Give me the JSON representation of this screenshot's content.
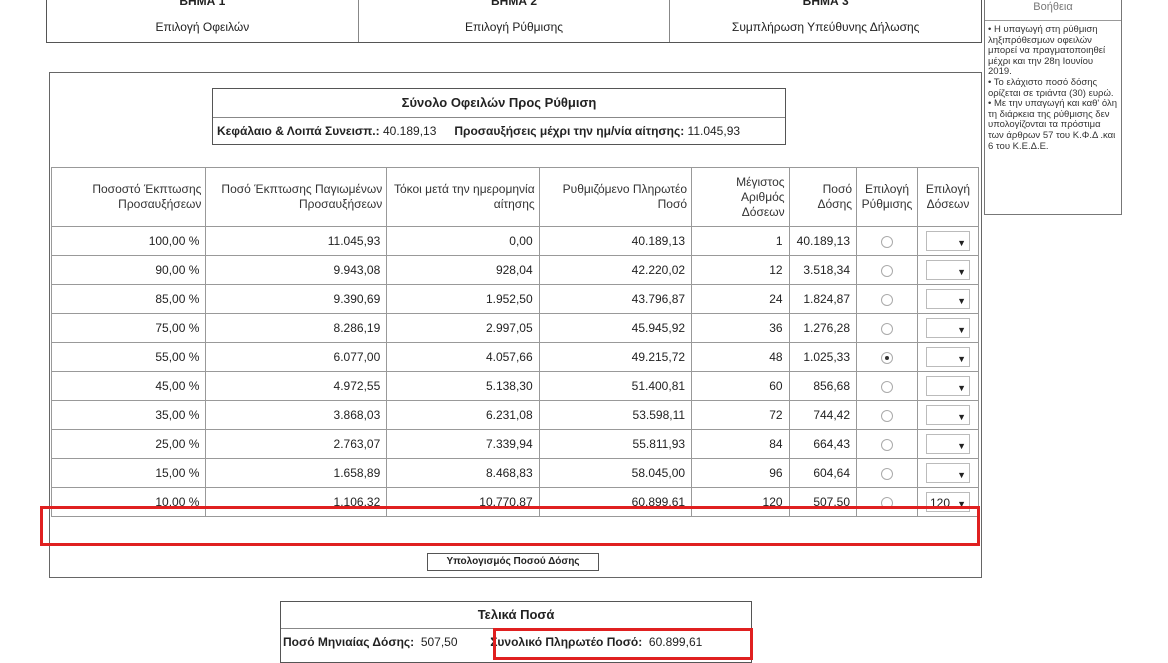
{
  "steps": [
    {
      "title": "ΒΗΜΑ 1",
      "label": "Επιλογή Οφειλών"
    },
    {
      "title": "ΒΗΜΑ 2",
      "label": "Επιλογή Ρύθμισης"
    },
    {
      "title": "ΒΗΜΑ 3",
      "label": "Συμπλήρωση Υπεύθυνης Δήλωσης"
    }
  ],
  "help": {
    "title": "Βοήθεια",
    "lines": [
      "• Η υπαγωγή στη ρύθμιση ληξιπρόθεσμων οφειλών μπορεί να πραγματοποιηθεί μέχρι και την 28η Ιουνίου 2019.",
      "• Το ελάχιστο ποσό δόσης ορίζεται σε τριάντα (30) ευρώ.",
      "• Με την υπαγωγή και καθ' όλη τη διάρκεια της ρύθμισης δεν υπολογίζονται τα πρόστιμα των άρθρων 57 του Κ.Φ.Δ .και 6 του Κ.Ε.Δ.Ε."
    ]
  },
  "summary": {
    "title": "Σύνολο Οφειλών Προς Ρύθμιση",
    "capital_label": "Κεφάλαιο & Λοιπά Συνεισπ.:",
    "capital_value": "40.189,13",
    "surcharge_label": "Προσαυξήσεις μέχρι την ημ/νία αίτησης:",
    "surcharge_value": "11.045,93"
  },
  "table": {
    "headers": [
      "Ποσοστό Έκπτωσης Προσαυξήσεων",
      "Ποσό Έκπτωσης Παγιωμένων Προσαυξήσεων",
      "Τόκοι μετά την ημερομηνία αίτησης",
      "Ρυθμιζόμενο Πληρωτέο Ποσό",
      "Μέγιστος Αριθμός Δόσεων",
      "Ποσό Δόσης",
      "Επιλογή Ρύθμισης",
      "Επιλογή Δόσεων"
    ],
    "rows": [
      {
        "pct": "100,00 %",
        "discount": "11.045,93",
        "interest": "0,00",
        "payable": "40.189,13",
        "max": "1",
        "installment": "40.189,13",
        "selected": false,
        "dose": ""
      },
      {
        "pct": "90,00 %",
        "discount": "9.943,08",
        "interest": "928,04",
        "payable": "42.220,02",
        "max": "12",
        "installment": "3.518,34",
        "selected": false,
        "dose": ""
      },
      {
        "pct": "85,00 %",
        "discount": "9.390,69",
        "interest": "1.952,50",
        "payable": "43.796,87",
        "max": "24",
        "installment": "1.824,87",
        "selected": false,
        "dose": ""
      },
      {
        "pct": "75,00 %",
        "discount": "8.286,19",
        "interest": "2.997,05",
        "payable": "45.945,92",
        "max": "36",
        "installment": "1.276,28",
        "selected": false,
        "dose": ""
      },
      {
        "pct": "55,00 %",
        "discount": "6.077,00",
        "interest": "4.057,66",
        "payable": "49.215,72",
        "max": "48",
        "installment": "1.025,33",
        "selected": true,
        "dose": ""
      },
      {
        "pct": "45,00 %",
        "discount": "4.972,55",
        "interest": "5.138,30",
        "payable": "51.400,81",
        "max": "60",
        "installment": "856,68",
        "selected": false,
        "dose": ""
      },
      {
        "pct": "35,00 %",
        "discount": "3.868,03",
        "interest": "6.231,08",
        "payable": "53.598,11",
        "max": "72",
        "installment": "744,42",
        "selected": false,
        "dose": ""
      },
      {
        "pct": "25,00 %",
        "discount": "2.763,07",
        "interest": "7.339,94",
        "payable": "55.811,93",
        "max": "84",
        "installment": "664,43",
        "selected": false,
        "dose": ""
      },
      {
        "pct": "15,00 %",
        "discount": "1.658,89",
        "interest": "8.468,83",
        "payable": "58.045,00",
        "max": "96",
        "installment": "604,64",
        "selected": false,
        "dose": ""
      },
      {
        "pct": "10,00 %",
        "discount": "1.106,32",
        "interest": "10.770,87",
        "payable": "60.899,61",
        "max": "120",
        "installment": "507,50",
        "selected": false,
        "dose": "120"
      }
    ]
  },
  "calc_button": "Υπολογισμός Ποσού Δόσης",
  "final": {
    "title": "Τελικά Ποσά",
    "monthly_label": "Ποσό Μηνιαίας Δόσης:",
    "monthly_value": "507,50",
    "total_label": "Συνολικό Πληρωτέο Ποσό:",
    "total_value": "60.899,61"
  },
  "highlight_color": "#e02020"
}
